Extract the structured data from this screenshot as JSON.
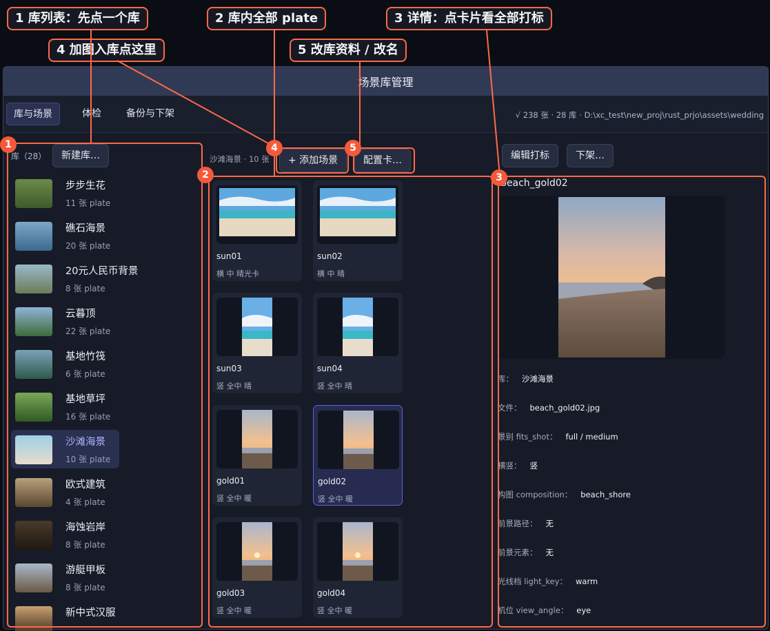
{
  "window": {
    "title": "场景库管理"
  },
  "tabs": [
    {
      "label": "库与场景",
      "active": true
    },
    {
      "label": "体检",
      "active": false
    },
    {
      "label": "备份与下架",
      "active": false
    }
  ],
  "status_text": "√ 238 张 · 28 库 · D:\\xc_test\\new_proj\\rust_prjo\\assets\\wedding",
  "library_panel": {
    "header": "库（28）",
    "new_button": "新建库…",
    "items": [
      {
        "name": "步步生花",
        "count": "11 张 plate",
        "selected": false
      },
      {
        "name": "礁石海景",
        "count": "20 张 plate",
        "selected": false
      },
      {
        "name": "20元人民币背景",
        "count": "8 张 plate",
        "selected": false
      },
      {
        "name": "云暮顶",
        "count": "22 张 plate",
        "selected": false
      },
      {
        "name": "基地竹筏",
        "count": "6 张 plate",
        "selected": false
      },
      {
        "name": "基地草坪",
        "count": "16 张 plate",
        "selected": false
      },
      {
        "name": "沙滩海景",
        "count": "10 张 plate",
        "selected": true
      },
      {
        "name": "欧式建筑",
        "count": "4 张 plate",
        "selected": false
      },
      {
        "name": "海蚀岩岸",
        "count": "8 张 plate",
        "selected": false
      },
      {
        "name": "游艇甲板",
        "count": "8 张 plate",
        "selected": false
      },
      {
        "name": "新中式汉服",
        "count": "",
        "selected": false
      }
    ]
  },
  "plate_panel": {
    "title": "沙滩海景 · 10 张",
    "add_button": "+ 添加场景",
    "config_button": "配置卡…",
    "cards": [
      {
        "name": "sun01",
        "tags": "横 中 晴光卡",
        "selected": false
      },
      {
        "name": "sun02",
        "tags": "横 中 晴",
        "selected": false
      },
      {
        "name": "sun03",
        "tags": "竖 全中 晴",
        "selected": false
      },
      {
        "name": "sun04",
        "tags": "竖 全中 晴",
        "selected": false
      },
      {
        "name": "gold01",
        "tags": "竖 全中 暖",
        "selected": false
      },
      {
        "name": "gold02",
        "tags": "竖 全中 暖",
        "selected": true
      },
      {
        "name": "gold03",
        "tags": "竖 全中 暖",
        "selected": false
      },
      {
        "name": "gold04",
        "tags": "竖 全中 暖",
        "selected": false
      }
    ]
  },
  "detail_panel": {
    "edit_button": "编辑打标",
    "remove_button": "下架…",
    "title": "beach_gold02",
    "fields": [
      {
        "key": "库：",
        "value": "沙滩海景"
      },
      {
        "key": "文件：",
        "value": "beach_gold02.jpg"
      },
      {
        "key": "景别 fits_shot：",
        "value": "full / medium"
      },
      {
        "key": "横竖：",
        "value": "竖"
      },
      {
        "key": "构图 composition：",
        "value": "beach_shore"
      },
      {
        "key": "前景路径：",
        "value": "无"
      },
      {
        "key": "前景元素：",
        "value": "无"
      },
      {
        "key": "光线档 light_key：",
        "value": "warm"
      },
      {
        "key": "机位 view_angle：",
        "value": "eye"
      }
    ]
  },
  "annotations": {
    "callouts": [
      "1  库列表：先点一个库",
      "2  库内全部 plate",
      "3  详情：点卡片看全部打标",
      "4  加图入库点这里",
      "5  改库资料 / 改名"
    ],
    "badges": [
      "1",
      "2",
      "3",
      "4",
      "5"
    ]
  },
  "colors": {
    "annotation": "#ff6a48",
    "accent": "#5d62d8",
    "selected_text": "#a9b4ff"
  }
}
